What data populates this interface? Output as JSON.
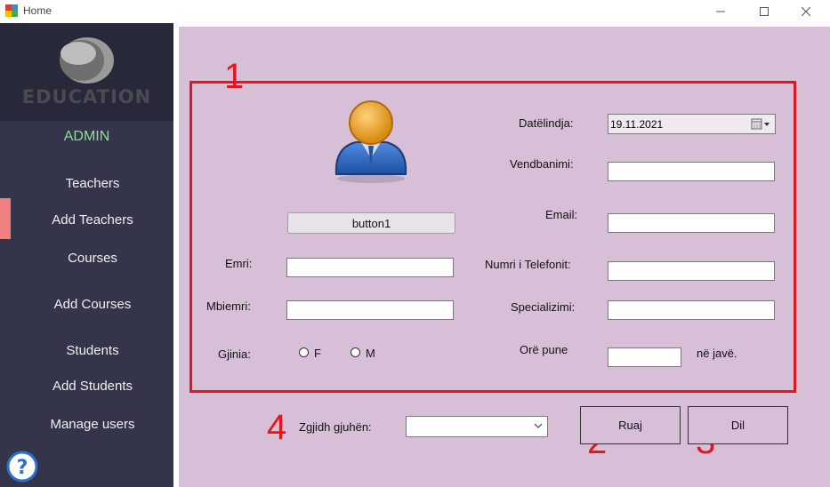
{
  "window": {
    "title": "Home",
    "minimize": "—",
    "maximize": "☐",
    "close": "✕"
  },
  "sidebar": {
    "logo_text": "EDUCATION",
    "role": "ADMIN",
    "items": [
      {
        "label": "Teachers"
      },
      {
        "label": "Add Teachers"
      },
      {
        "label": "Courses"
      },
      {
        "label": "Add Courses"
      },
      {
        "label": "Students"
      },
      {
        "label": "Add Students"
      },
      {
        "label": "Manage users"
      }
    ],
    "help_glyph": "?"
  },
  "annotations": {
    "n1": "1",
    "n2": "2",
    "n3": "3",
    "n4": "4"
  },
  "form": {
    "photo_button": "button1",
    "first_name_label": "Emri:",
    "first_name_value": "",
    "last_name_label": "Mbiemri:",
    "last_name_value": "",
    "gender_label": "Gjinia:",
    "gender_f": "F",
    "gender_m": "M",
    "dob_label": "Datëlindja:",
    "dob_value": "19.11.2021",
    "residence_label": "Vendbanimi:",
    "residence_value": "",
    "email_label": "Email:",
    "email_value": "",
    "phone_label": "Numri i Telefonit:",
    "phone_value": "",
    "specialization_label": "Specializimi:",
    "specialization_value": "",
    "hours_label": "Orë pune",
    "hours_value": "",
    "hours_suffix": "në javë."
  },
  "bottom": {
    "language_label": "Zgjidh gjuhën:",
    "language_value": "",
    "save_label": "Ruaj",
    "exit_label": "Dil"
  }
}
